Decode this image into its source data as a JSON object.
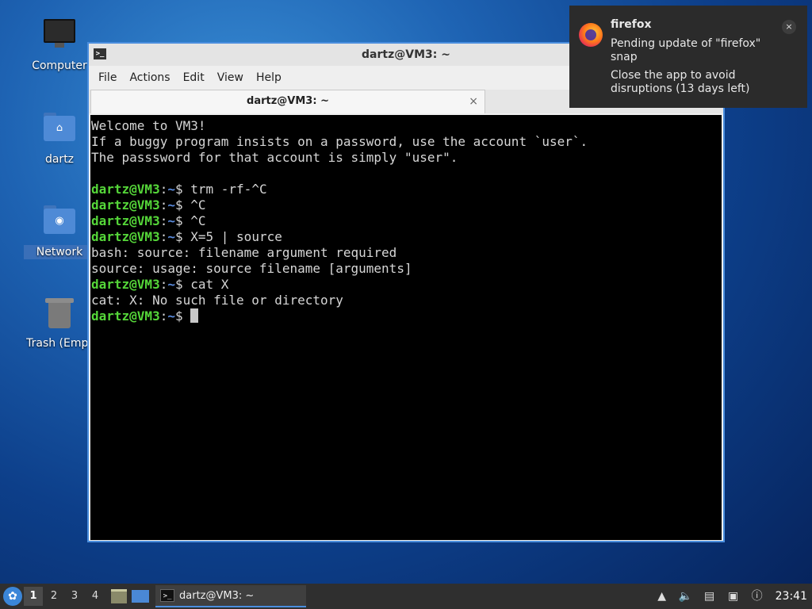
{
  "desktop": {
    "icons": [
      {
        "label": "Computer"
      },
      {
        "label": "dartz"
      },
      {
        "label": "Network"
      },
      {
        "label": "Trash (Empt"
      }
    ]
  },
  "window": {
    "title": "dartz@VM3: ~",
    "menu": [
      "File",
      "Actions",
      "Edit",
      "View",
      "Help"
    ],
    "tab_title": "dartz@VM3: ~",
    "tab_close": "×"
  },
  "terminal": {
    "prompt_user": "dartz@VM3",
    "prompt_sep": ":",
    "prompt_path": "~",
    "prompt_dollar": "$ ",
    "lines": [
      {
        "type": "out",
        "text": "Welcome to VM3!"
      },
      {
        "type": "out",
        "text": "If a buggy program insists on a password, use the account `user`."
      },
      {
        "type": "out",
        "text": "The passsword for that account is simply \"user\"."
      },
      {
        "type": "out",
        "text": ""
      },
      {
        "type": "cmd",
        "text": "trm -rf-^C"
      },
      {
        "type": "cmd",
        "text": "^C"
      },
      {
        "type": "cmd",
        "text": "^C"
      },
      {
        "type": "cmd",
        "text": "X=5 | source"
      },
      {
        "type": "out",
        "text": "bash: source: filename argument required"
      },
      {
        "type": "out",
        "text": "source: usage: source filename [arguments]"
      },
      {
        "type": "cmd",
        "text": "cat X"
      },
      {
        "type": "out",
        "text": "cat: X: No such file or directory"
      },
      {
        "type": "cmd",
        "text": "",
        "cursor": true
      }
    ]
  },
  "notification": {
    "app": "firefox",
    "line1": "Pending update of \"firefox\" snap",
    "line2": "Close the app to avoid disruptions (13 days left)",
    "close": "×"
  },
  "taskbar": {
    "workspaces": [
      "1",
      "2",
      "3",
      "4"
    ],
    "active_workspace": "1",
    "task_label": "dartz@VM3: ~",
    "clock": "23:41"
  }
}
